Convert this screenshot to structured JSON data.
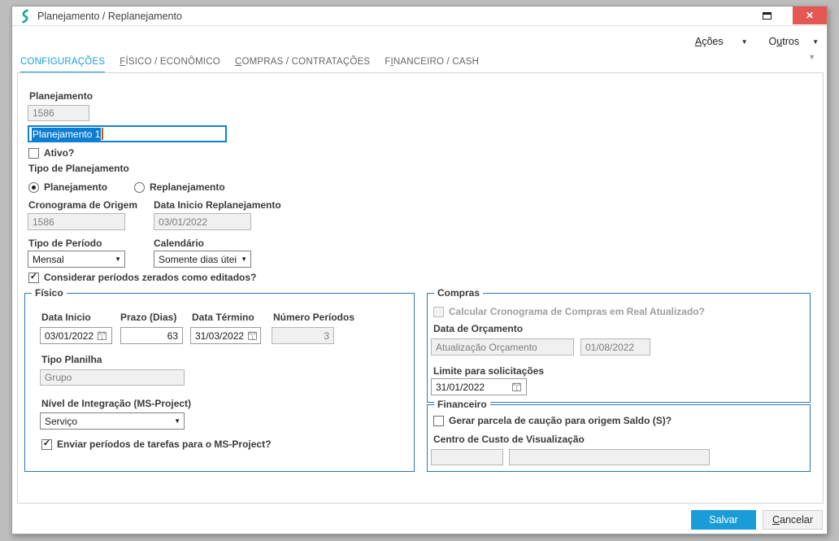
{
  "window": {
    "title": "Planejamento / Replanejamento"
  },
  "menubar": {
    "acoes": {
      "pre": "",
      "accel": "A",
      "post": "ções"
    },
    "outros": {
      "pre": "O",
      "accel": "u",
      "post": "tros"
    }
  },
  "tabs": [
    {
      "pre": "CONFIGURAÇÕES",
      "accel": "",
      "post": "",
      "active": true
    },
    {
      "pre": "",
      "accel": "F",
      "post": "ÍSICO / ECONÔMICO",
      "active": false
    },
    {
      "pre": "",
      "accel": "C",
      "post": "OMPRAS / CONTRATAÇÕES",
      "active": false
    },
    {
      "pre": "F",
      "accel": "I",
      "post": "NANCEIRO / CASH",
      "active": false
    }
  ],
  "form": {
    "planejamento": {
      "label": "Planejamento",
      "id_value": "1586"
    },
    "nome": {
      "value": "Planejamento 1",
      "selected": true
    },
    "ativo": {
      "label": "Ativo?",
      "checked": false
    },
    "tipo_planejamento": {
      "label": "Tipo de Planejamento",
      "options": [
        {
          "label": "Planejamento",
          "selected": true
        },
        {
          "label": "Replanejamento",
          "selected": false
        }
      ]
    },
    "cronograma_origem": {
      "label": "Cronograma de Origem",
      "value": "1586"
    },
    "data_inicio_replanejamento": {
      "label": "Data Inicio Replanejamento",
      "value": "03/01/2022"
    },
    "tipo_periodo": {
      "label": "Tipo de Período",
      "value": "Mensal"
    },
    "calendario": {
      "label": "Calendário",
      "value": "Somente dias útei"
    },
    "considerar_zerados": {
      "label": "Considerar períodos zerados como editados?",
      "checked": true
    }
  },
  "groups": {
    "fisico": {
      "title": "Físico",
      "data_inicio": {
        "label": "Data Inicio",
        "value": "03/01/2022"
      },
      "prazo": {
        "label": "Prazo (Dias)",
        "value": "63"
      },
      "data_termino": {
        "label": "Data Término",
        "value": "31/03/2022"
      },
      "numero_periodos": {
        "label": "Número Períodos",
        "value": "3"
      },
      "tipo_planilha": {
        "label": "Tipo Planilha",
        "value": "Grupo"
      },
      "nivel_integracao": {
        "label": "Nível de Integração (MS-Project)",
        "value": "Serviço"
      },
      "enviar_periodos": {
        "label": "Enviar períodos de tarefas para o MS-Project?",
        "checked": true
      }
    },
    "compras": {
      "title": "Compras",
      "calcular_real": {
        "label": "Calcular Cronograma de Compras em Real Atualizado?",
        "checked": false,
        "disabled": true
      },
      "data_orcamento": {
        "label": "Data de Orçamento",
        "tipo": "Atualização Orçamento",
        "data": "01/08/2022"
      },
      "limite_solicitacoes": {
        "label": "Limite para solicitações",
        "value": "31/01/2022"
      }
    },
    "financeiro": {
      "title": "Financeiro",
      "gerar_parcela": {
        "label": "Gerar parcela de caução para origem Saldo (S)?",
        "checked": false
      },
      "centro_custo": {
        "label": "Centro de Custo de Visualização",
        "codigo": "",
        "descricao": ""
      }
    }
  },
  "footer": {
    "salvar": "Salvar",
    "cancelar": {
      "pre": "",
      "accel": "C",
      "post": "ancelar"
    }
  },
  "icons": {
    "dropdown_arrow": "▼",
    "menu_chevron": "▼",
    "collapse_chevron": "▼",
    "check": "✓",
    "close": "✕"
  },
  "colors": {
    "accent_blue": "#1A9CD8",
    "group_border": "#2E75B6",
    "close_red": "#E45752",
    "logo_teal": "#1EA390",
    "selection_blue": "#0D7DD1"
  }
}
